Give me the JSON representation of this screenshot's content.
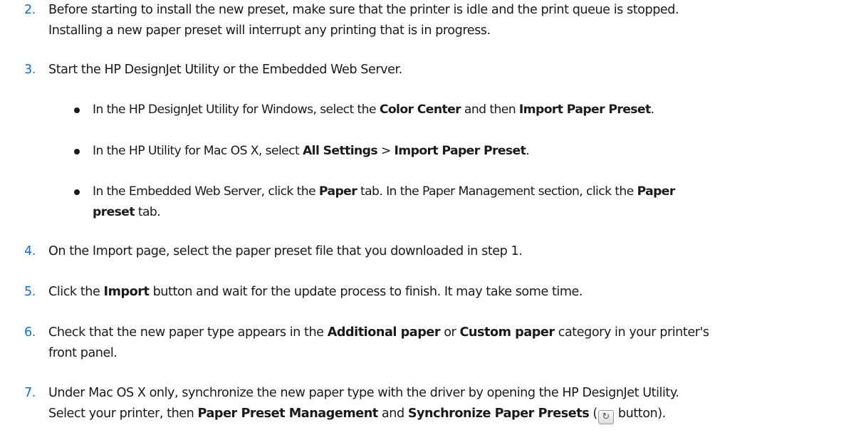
{
  "steps": {
    "s2": {
      "number": "2.",
      "line1": "Before starting to install the new preset, make sure that the printer is idle and the print queue is stopped.",
      "line2": "Installing a new paper preset will interrupt any printing that is in progress."
    },
    "s3": {
      "number": "3.",
      "text": "Start the HP DesignJet Utility or the Embedded Web Server.",
      "bullets": {
        "b1": {
          "t1": "In the HP DesignJet Utility for Windows, select the ",
          "b1": "Color Center",
          "t2": " and then ",
          "b2": "Import Paper Preset",
          "t3": "."
        },
        "b2": {
          "t1": "In the HP Utility for Mac OS X, select ",
          "b1": "All Settings",
          "t2": " > ",
          "b2": "Import Paper Preset",
          "t3": "."
        },
        "b3": {
          "t1": "In the Embedded Web Server, click the ",
          "b1": "Paper",
          "t2": " tab. In the Paper Management section, click the ",
          "b2": "Paper",
          "b3": "preset",
          "t3": " tab."
        }
      }
    },
    "s4": {
      "number": "4.",
      "text": "On the Import page, select the paper preset file that you downloaded in step 1."
    },
    "s5": {
      "number": "5.",
      "t1": "Click the ",
      "b1": "Import",
      "t2": " button and wait for the update process to finish. It may take some time."
    },
    "s6": {
      "number": "6.",
      "t1": "Check that the new paper type appears in the ",
      "b1": "Additional paper",
      "t2": " or ",
      "b2": "Custom paper",
      "t3": " category in your printer's",
      "line2": "front panel."
    },
    "s7": {
      "number": "7.",
      "line1": "Under Mac OS X only, synchronize the new paper type with the driver by opening the HP DesignJet Utility.",
      "t1": "Select your printer, then ",
      "b1": "Paper Preset Management",
      "t2": " and ",
      "b2": "Synchronize Paper Presets",
      "t3": " (",
      "icon": "sync-icon",
      "t4": " button)."
    }
  }
}
